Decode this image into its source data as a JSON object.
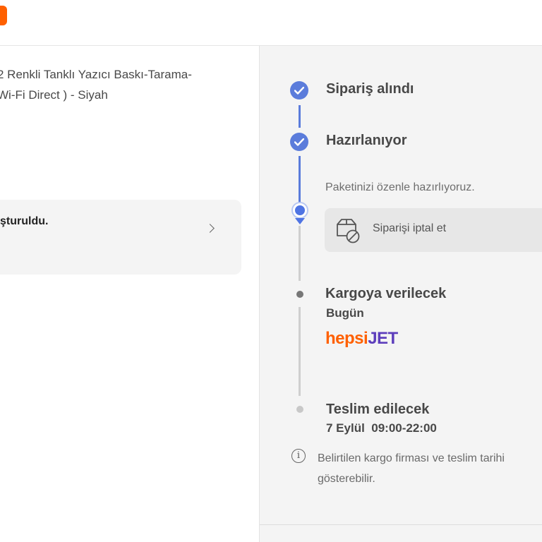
{
  "header": {
    "logo_icon": "brand-logo"
  },
  "product": {
    "title_line1": "2 Renkli Tanklı Yazıcı Baskı-Tarama-",
    "title_line2": "Wi-Fi Direct ) - Siyah"
  },
  "info_card": {
    "text": "şturuldu."
  },
  "timeline": {
    "steps": [
      {
        "label": "Sipariş alındı",
        "state": "done"
      },
      {
        "label": "Hazırlanıyor",
        "state": "current",
        "description": "Paketinizi özenle hazırlıyoruz."
      },
      {
        "label": "Kargoya verilecek",
        "state": "pending",
        "sub": "Bugün"
      },
      {
        "label": "Teslim edilecek",
        "state": "pending",
        "sub": "7 Eylül  09:00-22:00"
      }
    ],
    "cancel_button": {
      "label": "Siparişi iptal et",
      "icon": "package-cancel-icon"
    },
    "carrier": {
      "part1": "hepsi",
      "part2": "JET"
    },
    "note": {
      "icon": "info-icon",
      "text": "Belirtilen kargo firması ve teslim tarihi",
      "text_line2": "gösterebilir."
    }
  },
  "colors": {
    "accent_blue": "#5b7cdb",
    "brand_orange": "#ff6000",
    "carrier_purple": "#5d3ebc"
  }
}
